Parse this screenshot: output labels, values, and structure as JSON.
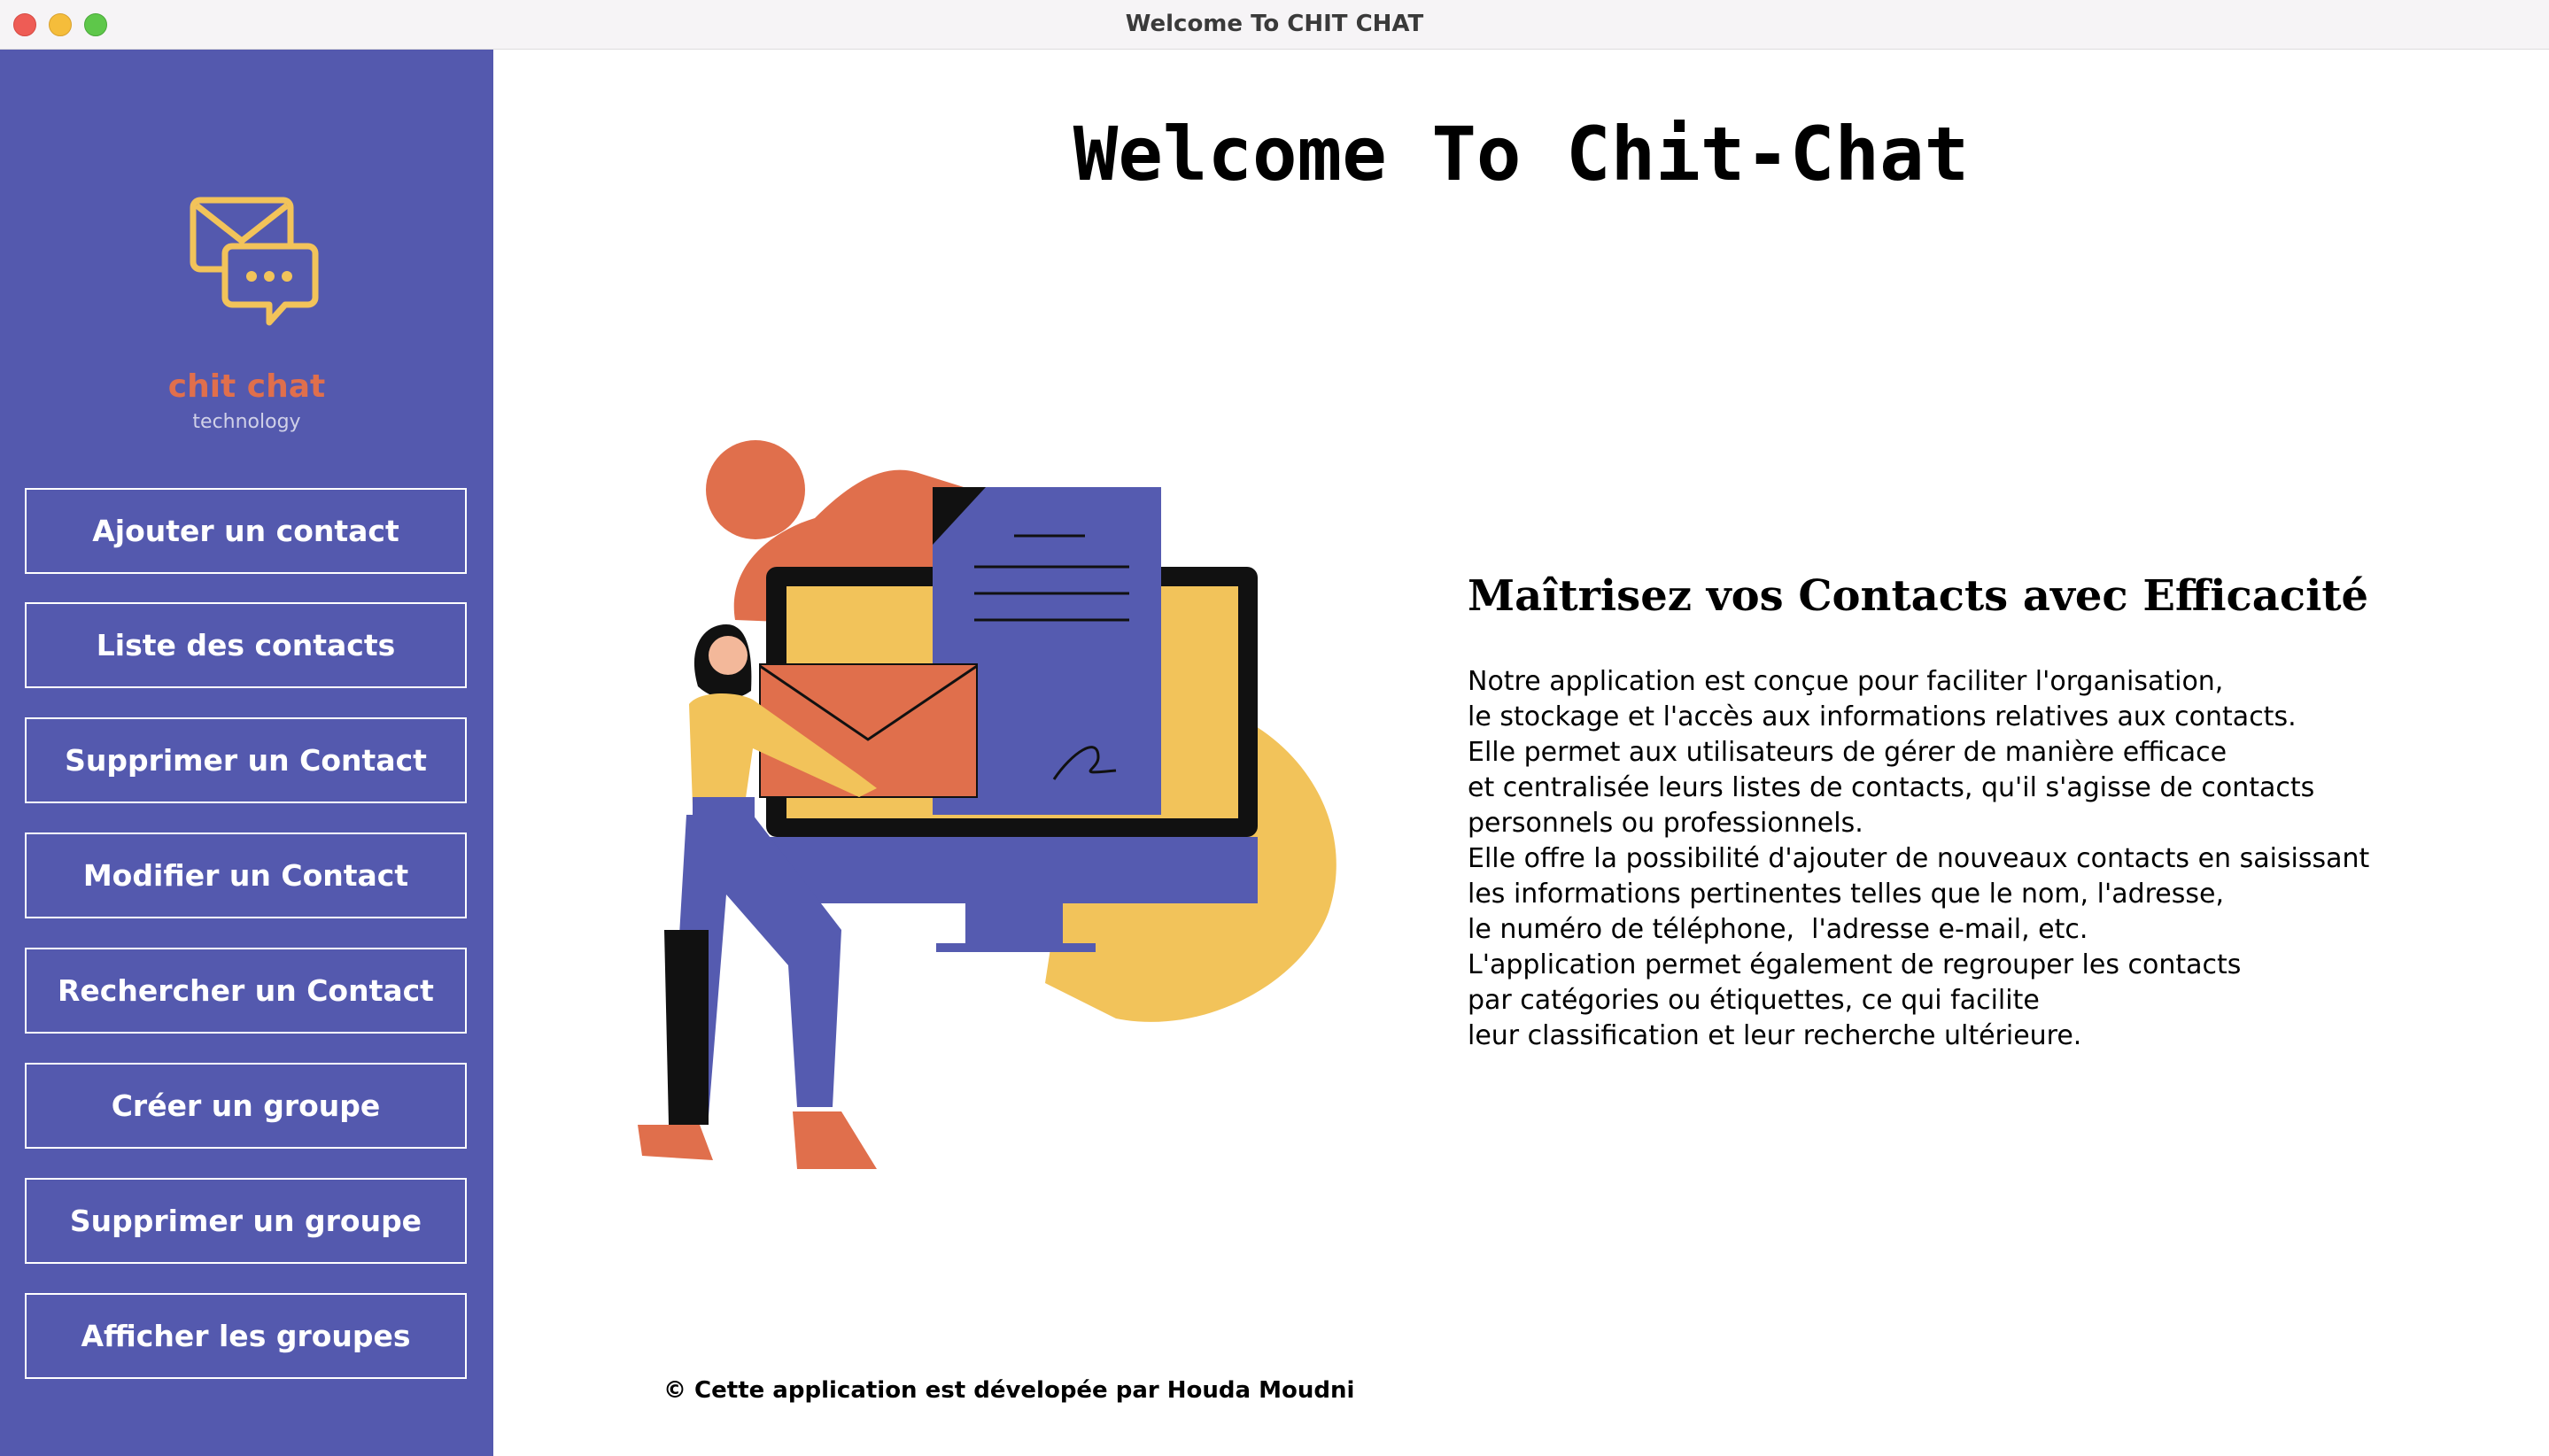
{
  "window": {
    "title": "Welcome To CHIT CHAT"
  },
  "sidebar": {
    "brand": {
      "name": "chit chat",
      "tagline": "technology"
    },
    "items": [
      {
        "label": "Ajouter un contact"
      },
      {
        "label": "Liste des contacts"
      },
      {
        "label": "Supprimer un Contact"
      },
      {
        "label": "Modifier un Contact"
      },
      {
        "label": "Rechercher un Contact"
      },
      {
        "label": "Créer un groupe"
      },
      {
        "label": "Supprimer un groupe"
      },
      {
        "label": "Afficher les groupes"
      }
    ]
  },
  "main": {
    "title": "Welcome To Chit-Chat",
    "heading": "Maîtrisez vos Contacts avec Efficacité",
    "description": [
      "Notre application est conçue pour faciliter l'organisation,",
      "le stockage et l'accès aux informations relatives aux contacts.",
      "Elle permet aux utilisateurs de gérer de manière efficace",
      "et centralisée leurs listes de contacts, qu'il s'agisse de contacts",
      "personnels ou professionnels.",
      "Elle offre la possibilité d'ajouter de nouveaux contacts en saisissant",
      "les informations pertinentes telles que le nom, l'adresse,",
      "le numéro de téléphone,  l'adresse e-mail, etc.",
      "L'application permet également de regrouper les contacts",
      "par catégories ou étiquettes, ce qui facilite",
      "leur classification et leur recherche ultérieure."
    ],
    "footer": "© Cette application est dévelopée par Houda Moudni"
  },
  "colors": {
    "sidebar_bg": "#5459ae",
    "brand_orange": "#e06f4c",
    "illustration_yellow": "#f2c35a",
    "illustration_blue": "#555bb0"
  },
  "icons": [
    "close-dot",
    "minimize-dot",
    "zoom-dot",
    "chat-envelope-logo-icon"
  ]
}
